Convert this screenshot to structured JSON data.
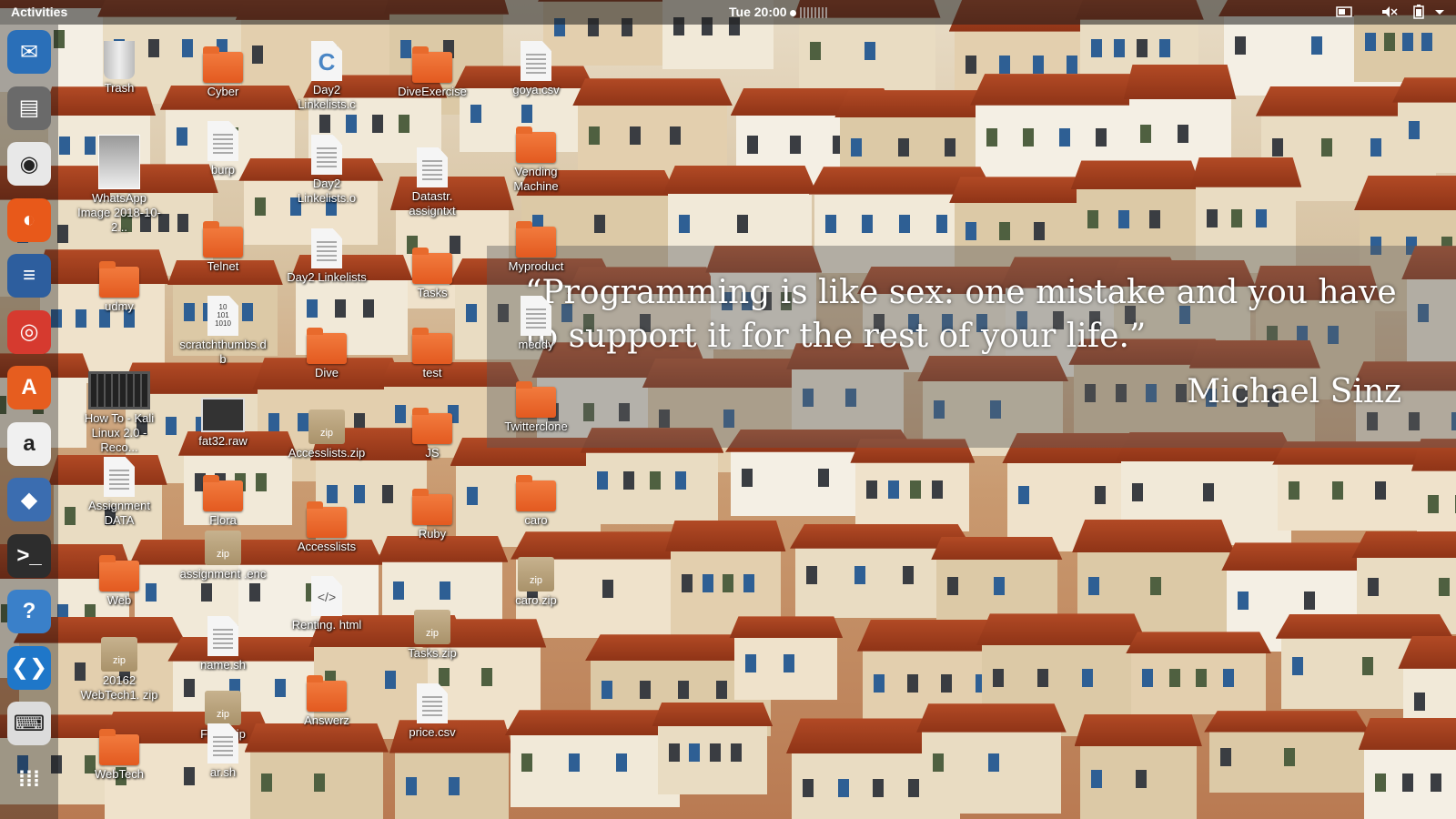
{
  "topbar": {
    "activities": "Activities",
    "clock": "Tue 20:00",
    "tray_icons": [
      "screen-icon",
      "volume-muted-icon",
      "battery-icon"
    ]
  },
  "dock": {
    "items": [
      {
        "name": "thunderbird-icon",
        "glyph": "✉",
        "color": "#2a6fb8"
      },
      {
        "name": "files-icon",
        "glyph": "▤",
        "color": "#6a6a6a"
      },
      {
        "name": "rhythmbox-icon",
        "glyph": "◉",
        "color": "#e8e8e8"
      },
      {
        "name": "firefox-icon",
        "glyph": "◐",
        "color": "#e8591a"
      },
      {
        "name": "libreoffice-writer-icon",
        "glyph": "≡",
        "color": "#2d5e9e"
      },
      {
        "name": "chrome-icon",
        "glyph": "◎",
        "color": "#d63a2f"
      },
      {
        "name": "software-center-icon",
        "glyph": "A",
        "color": "#e65d1f"
      },
      {
        "name": "amazon-icon",
        "glyph": "a",
        "color": "#f0f0f0"
      },
      {
        "name": "virtualbox-icon",
        "glyph": "◆",
        "color": "#3b6db0"
      },
      {
        "name": "terminal-icon",
        "glyph": ">_",
        "color": "#2d2d2d"
      },
      {
        "name": "help-icon",
        "glyph": "?",
        "color": "#3a80c9"
      },
      {
        "name": "vscode-icon",
        "glyph": "❮❯",
        "color": "#1f77c9"
      },
      {
        "name": "keyboard-icon",
        "glyph": "⌨",
        "color": "#dcdcdc"
      },
      {
        "name": "show-applications-icon",
        "glyph": "⁞⁞⁞",
        "color": "transparent"
      }
    ]
  },
  "desktop": {
    "icons": [
      {
        "label": "Trash",
        "kind": "trash"
      },
      {
        "label": "Cyber",
        "kind": "folder"
      },
      {
        "label": "Day2 Linkelists.c",
        "kind": "cfile"
      },
      {
        "label": "DiveExercise",
        "kind": "folder"
      },
      {
        "label": "goya.csv",
        "kind": "file"
      },
      {
        "label": "burp",
        "kind": "file"
      },
      {
        "label": "WhatsApp Image 2018-10-2...",
        "kind": "imgthumb"
      },
      {
        "label": "Day2 Linkelists.o",
        "kind": "file"
      },
      {
        "label": "Datastr. assigntxt",
        "kind": "file"
      },
      {
        "label": "Vending Machine",
        "kind": "folder"
      },
      {
        "label": "Telnet",
        "kind": "folder"
      },
      {
        "label": "Day2 Linkelists",
        "kind": "file"
      },
      {
        "label": "Tasks",
        "kind": "folder"
      },
      {
        "label": "Myproduct",
        "kind": "folder"
      },
      {
        "label": "udmy",
        "kind": "folder"
      },
      {
        "label": "scratchthumbs.db",
        "kind": "dbfile"
      },
      {
        "label": "Dive",
        "kind": "folder"
      },
      {
        "label": "test",
        "kind": "folder"
      },
      {
        "label": "meddy",
        "kind": "file"
      },
      {
        "label": "How To - Kali Linux 2.0 - Reco...",
        "kind": "videothumb"
      },
      {
        "label": "fat32.raw",
        "kind": "rawthumb"
      },
      {
        "label": "Accesslists.zip",
        "kind": "zip"
      },
      {
        "label": "JS",
        "kind": "folder"
      },
      {
        "label": "Twitterclone",
        "kind": "folder"
      },
      {
        "label": "Assignment DATA",
        "kind": "file"
      },
      {
        "label": "Flora",
        "kind": "folder"
      },
      {
        "label": "Accesslists",
        "kind": "folder"
      },
      {
        "label": "Ruby",
        "kind": "folder"
      },
      {
        "label": "caro",
        "kind": "folder"
      },
      {
        "label": "Web",
        "kind": "folder"
      },
      {
        "label": "assignment .enc",
        "kind": "zip"
      },
      {
        "label": "caro.zip",
        "kind": "zip"
      },
      {
        "label": "Renting. html",
        "kind": "htmlfile"
      },
      {
        "label": "Tasks.zip",
        "kind": "zip"
      },
      {
        "label": "20162 WebTech1. zip",
        "kind": "zip"
      },
      {
        "label": "name.sh",
        "kind": "file"
      },
      {
        "label": "Answerz",
        "kind": "folder"
      },
      {
        "label": "Flora.zip",
        "kind": "zip"
      },
      {
        "label": "price.csv",
        "kind": "file"
      },
      {
        "label": "WebTech",
        "kind": "folder"
      },
      {
        "label": "ar.sh",
        "kind": "file"
      }
    ]
  },
  "wallpaper_quote": {
    "text": "“Programming is like sex: one mistake and you have to support it for the rest of your life.”",
    "author": "Michael Sinz"
  }
}
